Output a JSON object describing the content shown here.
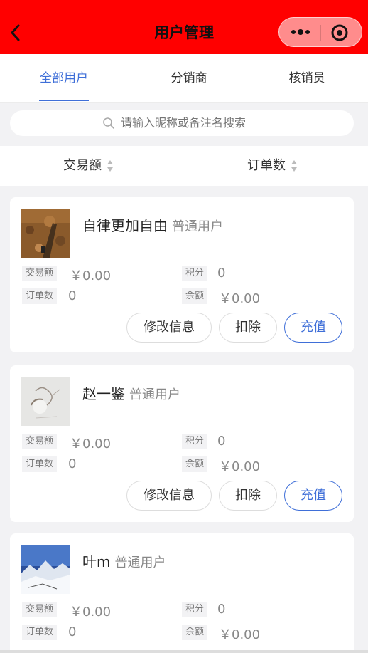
{
  "header": {
    "title": "用户管理",
    "background": "#ff0000",
    "back_icon": "chevron-left-icon",
    "more_icon": "more-dots-icon",
    "close_icon": "target-icon"
  },
  "tabs": [
    {
      "label": "全部用户",
      "active": true
    },
    {
      "label": "分销商",
      "active": false
    },
    {
      "label": "核销员",
      "active": false
    }
  ],
  "accent": "#3f6fd8",
  "search": {
    "placeholder": "请输入昵称或备注名搜索"
  },
  "sort": [
    {
      "label": "交易额"
    },
    {
      "label": "订单数"
    }
  ],
  "labels": {
    "trade": "交易额",
    "points": "积分",
    "orders": "订单数",
    "balance": "余额"
  },
  "actions": {
    "edit": "修改信息",
    "deduct": "扣除",
    "recharge": "充值"
  },
  "users": [
    {
      "name": "自律更加自由",
      "type": "普通用户",
      "trade": "￥0.00",
      "points": "0",
      "orders": "0",
      "balance": "￥0.00"
    },
    {
      "name": "赵一鉴",
      "type": "普通用户",
      "trade": "￥0.00",
      "points": "0",
      "orders": "0",
      "balance": "￥0.00"
    },
    {
      "name": "叶m",
      "type": "普通用户",
      "trade": "￥0.00",
      "points": "0",
      "orders": "0",
      "balance": "￥0.00"
    }
  ]
}
